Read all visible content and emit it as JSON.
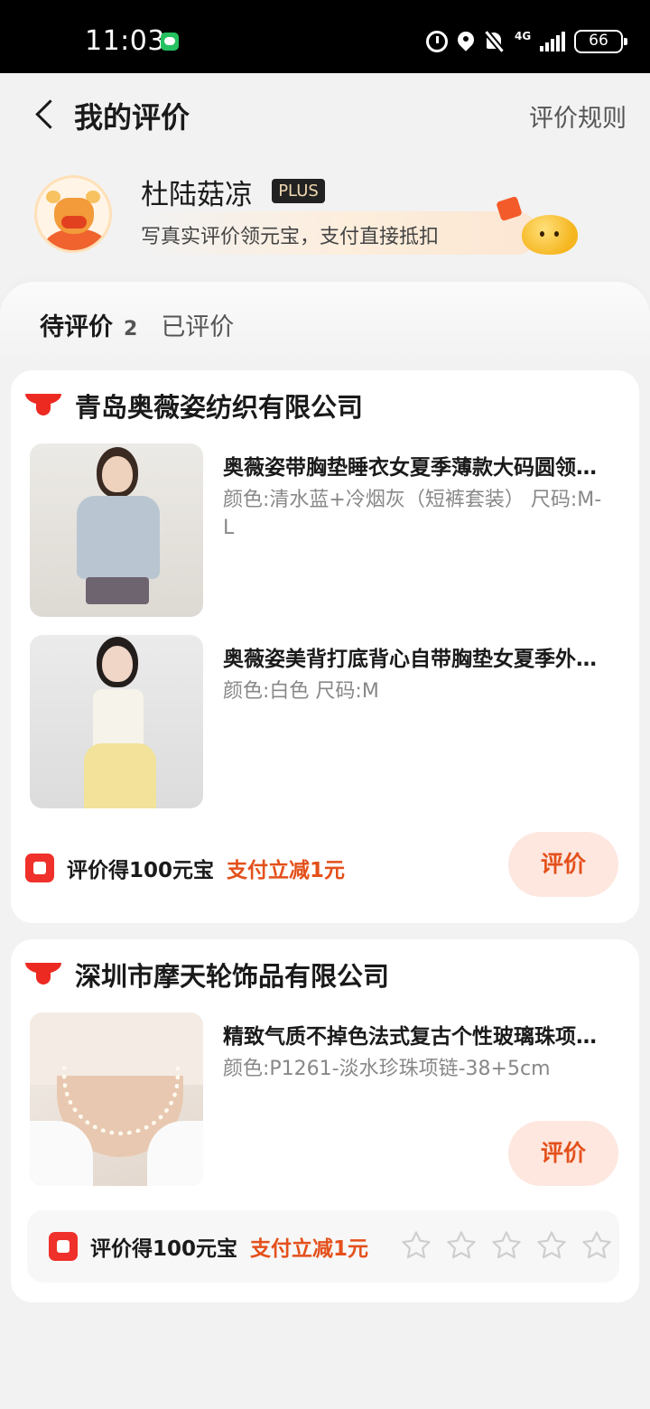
{
  "status_bar": {
    "time": "11:03",
    "network": "4G",
    "battery": "66"
  },
  "header": {
    "title": "我的评价",
    "rules_link": "评价规则"
  },
  "profile": {
    "username": "杜陆菇凉",
    "badge": "PLUS",
    "subtitle": "写真实评价领元宝，支付直接抵扣"
  },
  "tabs": {
    "pending_label": "待评价",
    "pending_count": "2",
    "done_label": "已评价"
  },
  "orders": [
    {
      "shop": "青岛奥薇姿纺织有限公司",
      "items": [
        {
          "title": "奥薇姿带胸垫睡衣女夏季薄款大码圆领短袖",
          "spec": "颜色:清水蓝+冷烟灰（短裤套装） 尺码:M-L"
        },
        {
          "title": "奥薇姿美背打底背心自带胸垫女夏季外穿吊带",
          "spec": "颜色:白色 尺码:M"
        }
      ],
      "reward_text": "评价得100元宝",
      "reward_discount": "支付立减1元",
      "review_button": "评价"
    },
    {
      "shop": "深圳市摩天轮饰品有限公司",
      "items": [
        {
          "title": "精致气质不掉色法式复古个性玻璃珠项链女",
          "spec": "颜色:P1261-淡水珍珠项链-38+5cm"
        }
      ],
      "reward_text": "评价得100元宝",
      "reward_discount": "支付立减1元",
      "review_button": "评价",
      "rating": {
        "max": 5,
        "value": 0
      }
    }
  ]
}
